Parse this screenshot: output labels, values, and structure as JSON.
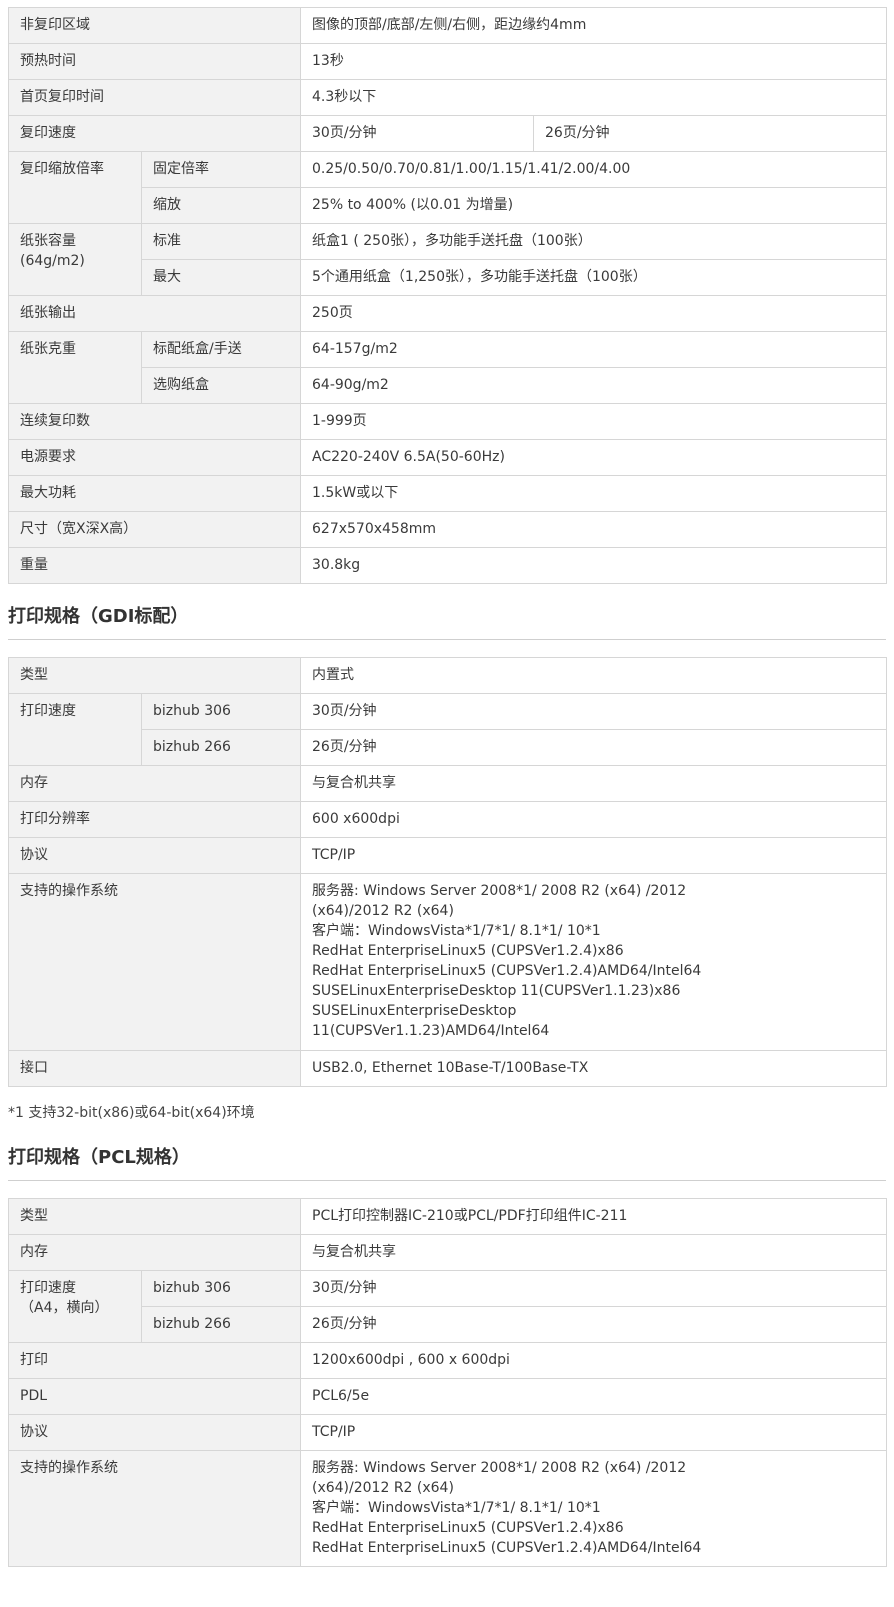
{
  "copy_spec": {
    "rows": [
      {
        "label": "非复印区域",
        "value": "图像的顶部/底部/左侧/右侧，距边缘约4mm"
      },
      {
        "label": "预热时间",
        "value": "13秒"
      },
      {
        "label": "首页复印时间",
        "value": "4.3秒以下"
      },
      {
        "label": "复印速度",
        "value_a": "30页/分钟",
        "value_b": "26页/分钟"
      },
      {
        "label": "复印缩放倍率",
        "sub1": "固定倍率",
        "val1": "0.25/0.50/0.70/0.81/1.00/1.15/1.41/2.00/4.00",
        "sub2": "缩放",
        "val2": "25% to 400% (以0.01 为增量)"
      },
      {
        "label_l1": "纸张容量",
        "label_l2": "(64g/m2)",
        "sub1": "标准",
        "val1": "纸盒1 ( 250张），多功能手送托盘（100张）",
        "sub2": "最大",
        "val2": "5个通用纸盒（1,250张），多功能手送托盘（100张）"
      },
      {
        "label": "纸张输出",
        "value": "250页"
      },
      {
        "label": "纸张克重",
        "sub1": "标配纸盒/手送",
        "val1": "64-157g/m2",
        "sub2": "选购纸盒",
        "val2": "64-90g/m2"
      },
      {
        "label": "连续复印数",
        "value": "1-999页"
      },
      {
        "label": "电源要求",
        "value": "AC220-240V 6.5A(50-60Hz)"
      },
      {
        "label": "最大功耗",
        "value": "1.5kW或以下"
      },
      {
        "label": "尺寸（宽X深X高）",
        "value": "627x570x458mm"
      },
      {
        "label": "重量",
        "value": "30.8kg"
      }
    ]
  },
  "gdi": {
    "heading": "打印规格（GDI标配）",
    "rows": [
      {
        "label": "类型",
        "value": "内置式"
      },
      {
        "label": "打印速度",
        "sub1": "bizhub 306",
        "val1": "30页/分钟",
        "sub2": "bizhub 266",
        "val2": "26页/分钟"
      },
      {
        "label": "内存",
        "value": "与复合机共享"
      },
      {
        "label": "打印分辨率",
        "value": "600 x600dpi"
      },
      {
        "label": "协议",
        "value": "TCP/IP"
      },
      {
        "label": "支持的操作系统",
        "lines": [
          "服务器: Windows Server 2008*1/ 2008 R2 (x64) /2012",
          "(x64)/2012 R2 (x64)",
          "客户端：WindowsVista*1/7*1/ 8.1*1/ 10*1",
          "RedHat EnterpriseLinux5 (CUPSVer1.2.4)x86",
          "RedHat EnterpriseLinux5 (CUPSVer1.2.4)AMD64/Intel64",
          "SUSELinuxEnterpriseDesktop 11(CUPSVer1.1.23)x86",
          "SUSELinuxEnterpriseDesktop",
          "11(CUPSVer1.1.23)AMD64/Intel64"
        ]
      },
      {
        "label": "接口",
        "value": "USB2.0, Ethernet 10Base-T/100Base-TX"
      }
    ],
    "footnote": "*1 支持32-bit(x86)或64-bit(x64)环境"
  },
  "pcl": {
    "heading": "打印规格（PCL规格）",
    "rows": [
      {
        "label": "类型",
        "value": "PCL打印控制器IC-210或PCL/PDF打印组件IC-211"
      },
      {
        "label": "内存",
        "value": "与复合机共享"
      },
      {
        "label_l1": "打印速度",
        "label_l2": "（A4，横向）",
        "sub1": "bizhub 306",
        "val1": "30页/分钟",
        "sub2": "bizhub 266",
        "val2": "26页/分钟"
      },
      {
        "label": "打印",
        "value": "1200x600dpi , 600 x 600dpi"
      },
      {
        "label": "PDL",
        "value": "PCL6/5e"
      },
      {
        "label": "协议",
        "value": "TCP/IP"
      },
      {
        "label": "支持的操作系统",
        "lines": [
          "服务器: Windows Server 2008*1/ 2008 R2 (x64) /2012",
          "(x64)/2012 R2 (x64)",
          "客户端：WindowsVista*1/7*1/ 8.1*1/ 10*1",
          "RedHat EnterpriseLinux5 (CUPSVer1.2.4)x86",
          "RedHat EnterpriseLinux5 (CUPSVer1.2.4)AMD64/Intel64"
        ]
      }
    ]
  }
}
